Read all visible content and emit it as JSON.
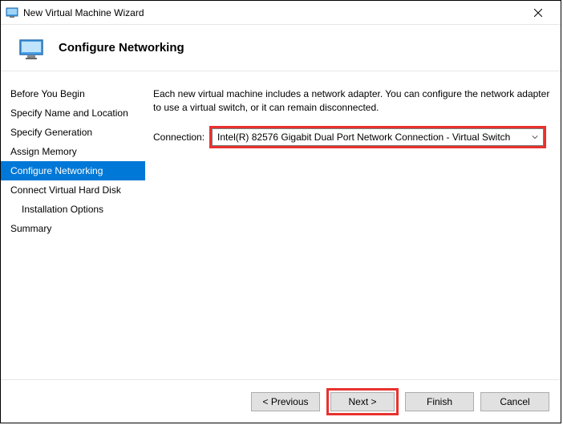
{
  "window": {
    "title": "New Virtual Machine Wizard"
  },
  "header": {
    "title": "Configure Networking"
  },
  "sidebar": {
    "steps": {
      "before": "Before You Begin",
      "name": "Specify Name and Location",
      "gen": "Specify Generation",
      "mem": "Assign Memory",
      "net": "Configure Networking",
      "vhd": "Connect Virtual Hard Disk",
      "install": "Installation Options",
      "summary": "Summary"
    }
  },
  "main": {
    "description": "Each new virtual machine includes a network adapter. You can configure the network adapter to use a virtual switch, or it can remain disconnected.",
    "connection_label": "Connection:",
    "connection_value": "Intel(R) 82576 Gigabit Dual Port Network Connection - Virtual Switch"
  },
  "footer": {
    "previous": "< Previous",
    "next": "Next >",
    "finish": "Finish",
    "cancel": "Cancel"
  }
}
